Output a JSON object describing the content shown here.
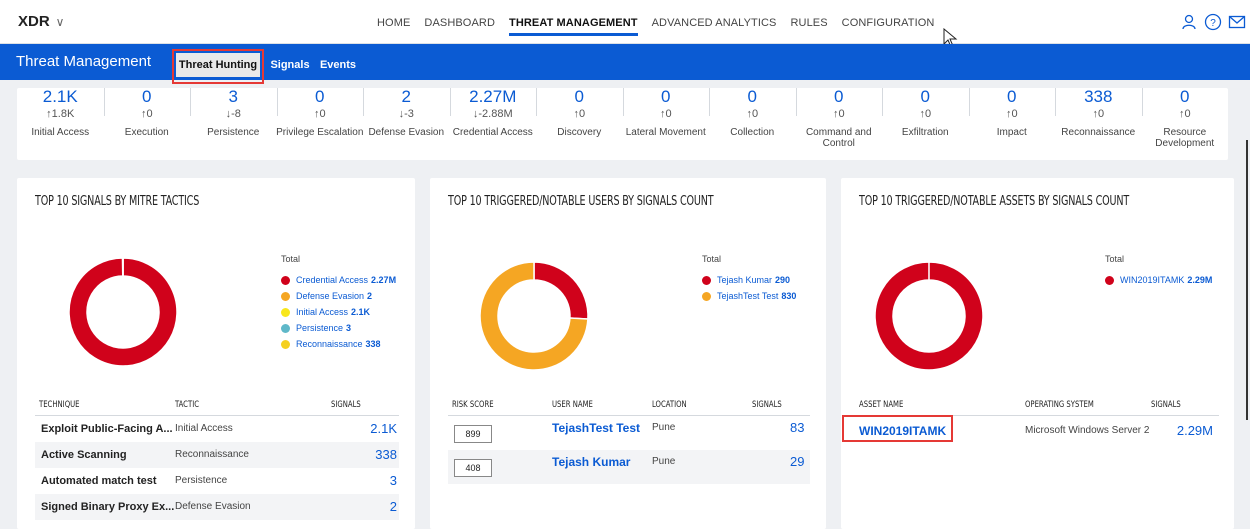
{
  "nav": {
    "brand": "XDR",
    "links": [
      "HOME",
      "DASHBOARD",
      "THREAT MANAGEMENT",
      "ADVANCED ANALYTICS",
      "RULES",
      "CONFIGURATION"
    ],
    "active": "THREAT MANAGEMENT"
  },
  "subheader": {
    "title": "Threat Management",
    "tabs": [
      "Threat Hunting",
      "Signals",
      "Events"
    ],
    "selected_tab": "Threat Hunting"
  },
  "tactics": [
    {
      "value": "2.1K",
      "delta": "↑1.8K",
      "name": "Initial Access"
    },
    {
      "value": "0",
      "delta": "↑0",
      "name": "Execution"
    },
    {
      "value": "3",
      "delta": "↓-8",
      "name": "Persistence"
    },
    {
      "value": "0",
      "delta": "↑0",
      "name": "Privilege Escalation"
    },
    {
      "value": "2",
      "delta": "↓-3",
      "name": "Defense Evasion"
    },
    {
      "value": "2.27M",
      "delta": "↓-2.88M",
      "name": "Credential Access"
    },
    {
      "value": "0",
      "delta": "↑0",
      "name": "Discovery"
    },
    {
      "value": "0",
      "delta": "↑0",
      "name": "Lateral Movement"
    },
    {
      "value": "0",
      "delta": "↑0",
      "name": "Collection"
    },
    {
      "value": "0",
      "delta": "↑0",
      "name": "Command and Control"
    },
    {
      "value": "0",
      "delta": "↑0",
      "name": "Exfiltration"
    },
    {
      "value": "0",
      "delta": "↑0",
      "name": "Impact"
    },
    {
      "value": "338",
      "delta": "↑0",
      "name": "Reconnaissance"
    },
    {
      "value": "0",
      "delta": "↑0",
      "name": "Resource Development"
    }
  ],
  "cards": {
    "mitre": {
      "title": "TOP 10 SIGNALS BY MITRE TACTICS",
      "legend_title": "Total",
      "legend": [
        {
          "label": "Credential Access",
          "value": "2.27M",
          "color": "#d0021b"
        },
        {
          "label": "Defense Evasion",
          "value": "2",
          "color": "#f5a623"
        },
        {
          "label": "Initial Access",
          "value": "2.1K",
          "color": "#f8e71c"
        },
        {
          "label": "Persistence",
          "value": "3",
          "color": "#5fb8c9"
        },
        {
          "label": "Reconnaissance",
          "value": "338",
          "color": "#f5d020"
        }
      ],
      "columns": [
        "TECHNIQUE",
        "TACTIC",
        "SIGNALS"
      ],
      "rows": [
        {
          "technique": "Exploit Public-Facing A...",
          "tactic": "Initial Access",
          "signals": "2.1K"
        },
        {
          "technique": "Active Scanning",
          "tactic": "Reconnaissance",
          "signals": "338"
        },
        {
          "technique": "Automated match test",
          "tactic": "Persistence",
          "signals": "3"
        },
        {
          "technique": "Signed Binary Proxy Ex...",
          "tactic": "Defense Evasion",
          "signals": "2"
        }
      ]
    },
    "users": {
      "title": "TOP 10 TRIGGERED/NOTABLE USERS BY SIGNALS COUNT",
      "legend_title": "Total",
      "legend": [
        {
          "label": "Tejash Kumar",
          "value": "290",
          "color": "#d0021b"
        },
        {
          "label": "TejashTest Test",
          "value": "830",
          "color": "#f5a623"
        }
      ],
      "columns": [
        "RISK SCORE",
        "USER NAME",
        "LOCATION",
        "SIGNALS"
      ],
      "rows": [
        {
          "risk": "899",
          "user": "TejashTest Test",
          "location": "Pune",
          "signals": "83"
        },
        {
          "risk": "408",
          "user": "Tejash Kumar",
          "location": "Pune",
          "signals": "29"
        }
      ]
    },
    "assets": {
      "title": "TOP 10 TRIGGERED/NOTABLE ASSETS BY SIGNALS COUNT",
      "legend_title": "Total",
      "legend": [
        {
          "label": "WIN2019ITAMK",
          "value": "2.29M",
          "color": "#d0021b"
        }
      ],
      "columns": [
        "ASSET NAME",
        "OPERATING SYSTEM",
        "SIGNALS"
      ],
      "rows": [
        {
          "asset": "WIN2019ITAMK",
          "os": "Microsoft Windows Server 2",
          "signals": "2.29M"
        }
      ]
    }
  },
  "chart_data": [
    {
      "type": "pie",
      "title": "TOP 10 SIGNALS BY MITRE TACTICS",
      "categories": [
        "Credential Access",
        "Defense Evasion",
        "Initial Access",
        "Persistence",
        "Reconnaissance"
      ],
      "values": [
        2270000,
        2,
        2100,
        3,
        338
      ]
    },
    {
      "type": "pie",
      "title": "TOP 10 TRIGGERED/NOTABLE USERS BY SIGNALS COUNT",
      "categories": [
        "Tejash Kumar",
        "TejashTest Test"
      ],
      "values": [
        290,
        830
      ]
    },
    {
      "type": "pie",
      "title": "TOP 10 TRIGGERED/NOTABLE ASSETS BY SIGNALS COUNT",
      "categories": [
        "WIN2019ITAMK"
      ],
      "values": [
        2290000
      ]
    }
  ]
}
